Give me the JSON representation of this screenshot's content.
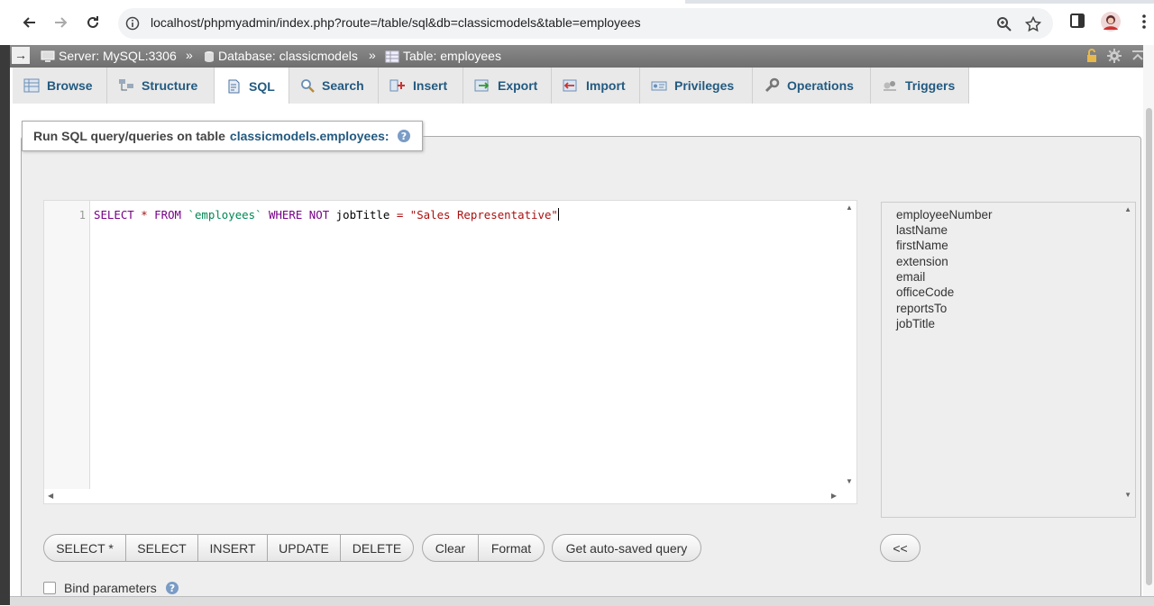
{
  "browser": {
    "url": "localhost/phpmyadmin/index.php?route=/table/sql&db=classicmodels&table=employees",
    "icons": [
      "back-icon",
      "forward-icon",
      "reload-icon",
      "info-icon",
      "zoom-icon",
      "star-icon",
      "sidepanel-icon",
      "profile-avatar",
      "menu-icon"
    ]
  },
  "breadcrumb": {
    "server": "Server: MySQL:3306",
    "database": "Database: classicmodels",
    "table": "Table: employees",
    "sep": "»",
    "arrow": "→"
  },
  "tabs": [
    {
      "label": "Browse",
      "icon": "browse-icon"
    },
    {
      "label": "Structure",
      "icon": "structure-icon"
    },
    {
      "label": "SQL",
      "icon": "sql-icon",
      "active": true
    },
    {
      "label": "Search",
      "icon": "search-icon"
    },
    {
      "label": "Insert",
      "icon": "insert-icon"
    },
    {
      "label": "Export",
      "icon": "export-icon"
    },
    {
      "label": "Import",
      "icon": "import-icon"
    },
    {
      "label": "Privileges",
      "icon": "privileges-icon"
    },
    {
      "label": "Operations",
      "icon": "operations-icon"
    },
    {
      "label": "Triggers",
      "icon": "triggers-icon"
    }
  ],
  "sql_panel": {
    "legend_prefix": "Run SQL query/queries on table",
    "legend_table": "classicmodels.employees:",
    "line_number": "1",
    "query": {
      "select": "SELECT",
      "star": "*",
      "from": "FROM",
      "table": "`employees`",
      "where": "WHERE",
      "not": "NOT",
      "column": "jobTitle",
      "eq": "=",
      "value": "\"Sales Representative\""
    }
  },
  "columns": [
    "employeeNumber",
    "lastName",
    "firstName",
    "extension",
    "email",
    "officeCode",
    "reportsTo",
    "jobTitle"
  ],
  "buttons": {
    "select_star": "SELECT *",
    "select": "SELECT",
    "insert": "INSERT",
    "update": "UPDATE",
    "delete": "DELETE",
    "clear": "Clear",
    "format": "Format",
    "autosaved": "Get auto-saved query",
    "insert_col": "<<"
  },
  "bind_parameters": {
    "label": "Bind parameters",
    "checked": false
  },
  "colors": {
    "link": "#235a81",
    "tabbar": "#e9e9e9",
    "breadcrumb": "#7a7a7a"
  }
}
